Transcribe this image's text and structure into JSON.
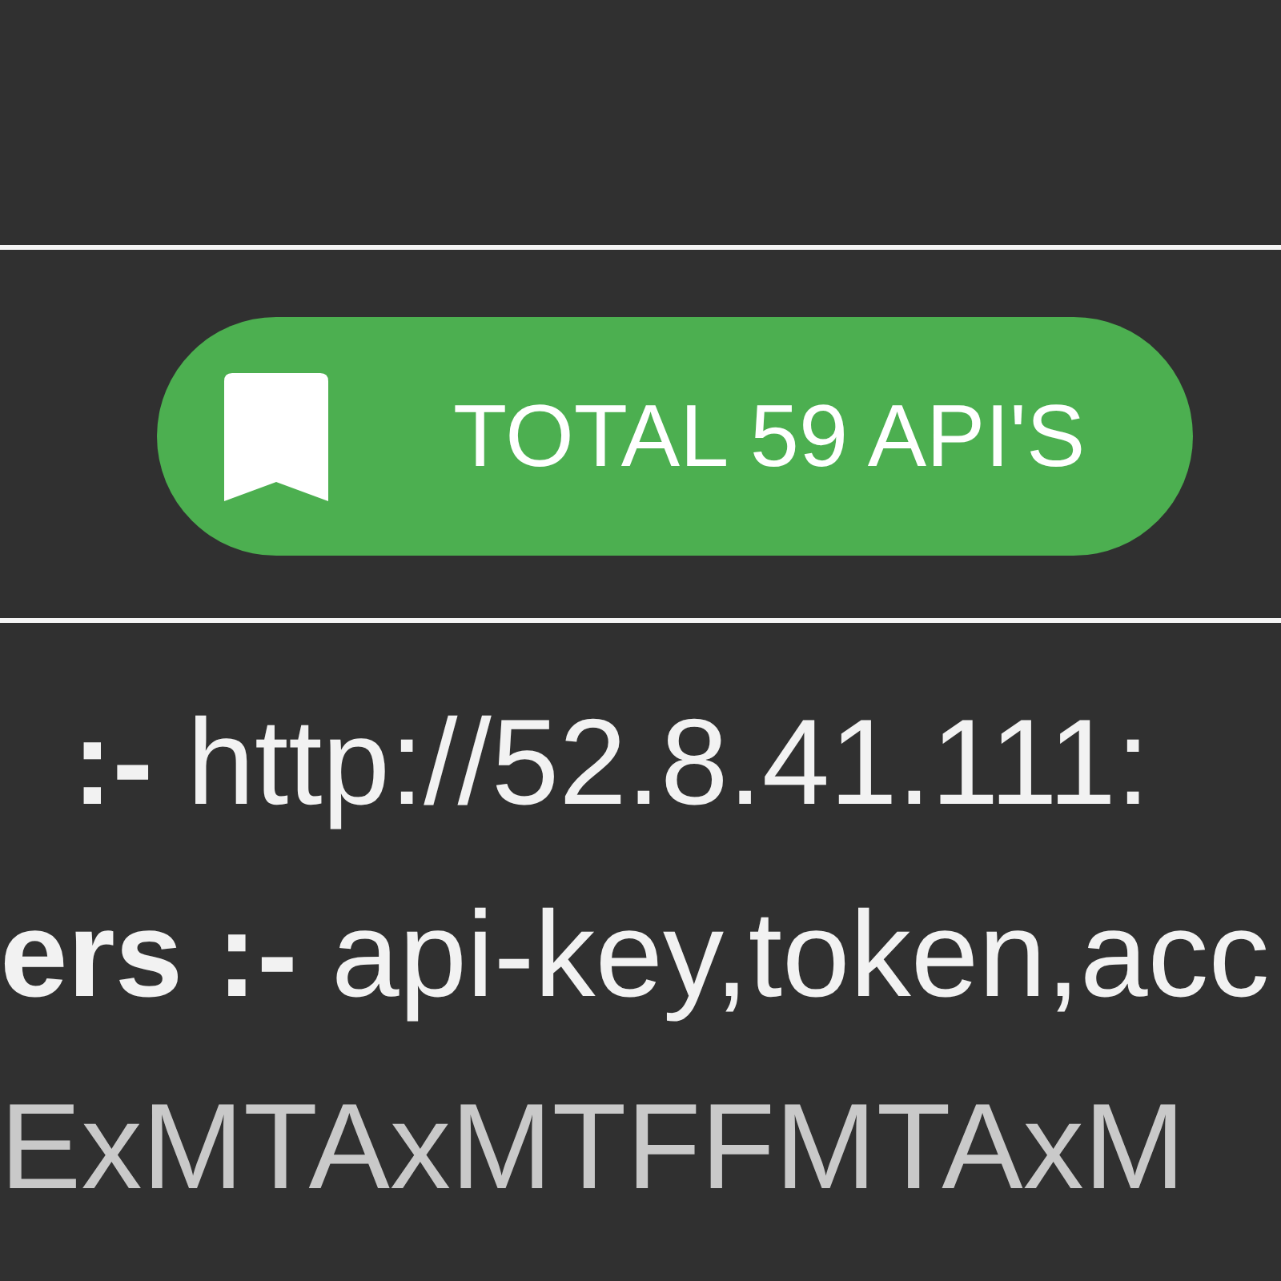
{
  "badge": {
    "label": "TOTAL 59 API'S"
  },
  "details": [
    {
      "kind": "field",
      "text": "**:-** http://52.8.41.111:"
    },
    {
      "kind": "field",
      "text": "**ers :-** api-key,token,acc"
    },
    {
      "kind": "token",
      "text": "ExMTAxMTFFMTAxM"
    }
  ]
}
